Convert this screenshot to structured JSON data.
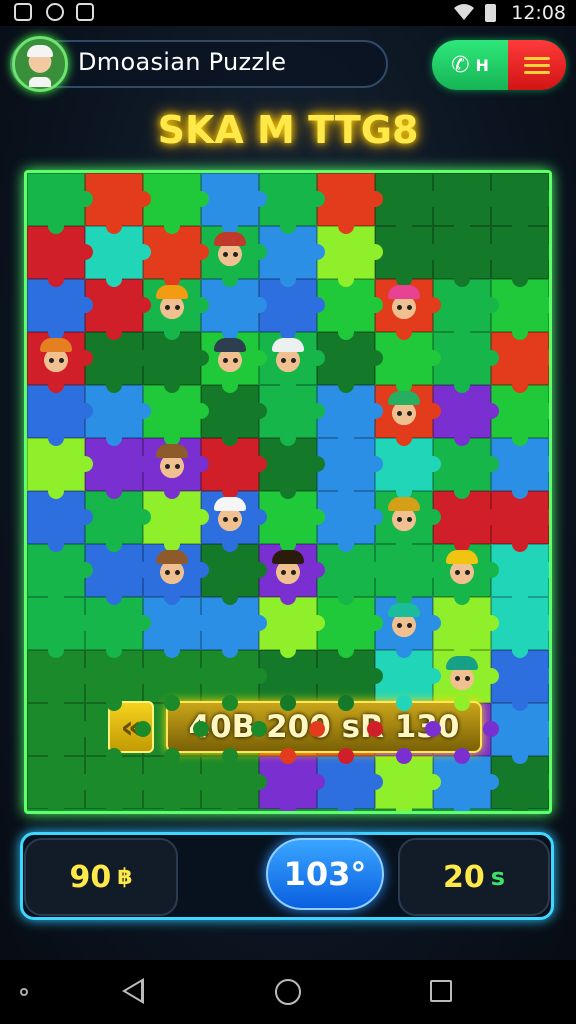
{
  "status_bar": {
    "time": "12:08",
    "icons": [
      "notification-icon",
      "sync-icon",
      "download-icon",
      "wifi-icon",
      "battery-icon"
    ]
  },
  "header": {
    "title": "Dmoasian Puzzle",
    "call_label": "H",
    "icons": {
      "avatar": "avatar",
      "call": "phone-icon",
      "menu": "hamburger-menu-icon"
    }
  },
  "level": {
    "title": "SKA M TTG8"
  },
  "board": {
    "progress_text": "40B 200 sR 130",
    "back_icon": "double-chevron-left-icon",
    "colors": [
      "#d11f2a",
      "#1fc93a",
      "#2b8fe6",
      "#7a2fd0",
      "#16b64a",
      "#e23c1c",
      "#2e6fe0",
      "#8fef2a",
      "#21d6b8",
      "#147a2a"
    ]
  },
  "stats": {
    "left_value": "90",
    "left_unit": "฿",
    "center_value": "103°",
    "right_value": "20",
    "right_unit": "s"
  },
  "nav": {
    "icons": [
      "menu-dot-icon",
      "back-icon",
      "home-icon",
      "recent-apps-icon"
    ]
  }
}
